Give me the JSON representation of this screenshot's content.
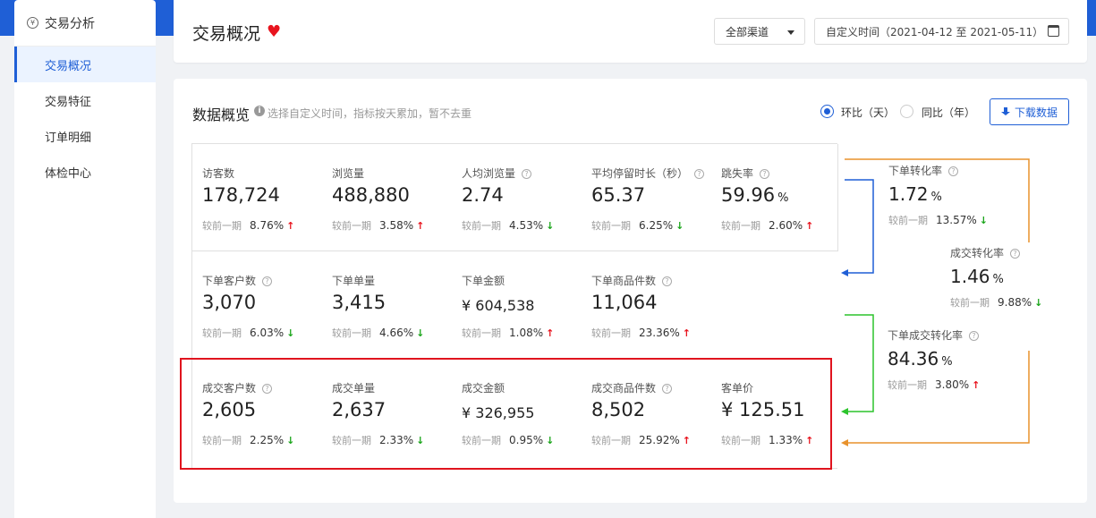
{
  "sidebar": {
    "title": "交易分析",
    "items": [
      {
        "label": "交易概况",
        "active": true
      },
      {
        "label": "交易特征",
        "active": false
      },
      {
        "label": "订单明细",
        "active": false
      },
      {
        "label": "体检中心",
        "active": false
      }
    ]
  },
  "header": {
    "title": "交易概况",
    "channel": "全部渠道",
    "date_range": "自定义时间（2021-04-12 至 2021-05-11）"
  },
  "overview": {
    "title": "数据概览",
    "hint": "选择自定义时间，指标按天累加，暂不去重",
    "radio_mom": "环比（天）",
    "radio_yoy": "同比（年）",
    "download": "下载数据",
    "compare_label": "较前一期"
  },
  "metrics": {
    "r1": [
      {
        "label": "访客数",
        "help": false,
        "value": "178,724",
        "unit": "",
        "pct": "8.76%",
        "dir": "up"
      },
      {
        "label": "浏览量",
        "help": false,
        "value": "488,880",
        "unit": "",
        "pct": "3.58%",
        "dir": "up"
      },
      {
        "label": "人均浏览量",
        "help": true,
        "value": "2.74",
        "unit": "",
        "pct": "4.53%",
        "dir": "down"
      },
      {
        "label": "平均停留时长（秒）",
        "help": true,
        "value": "65.37",
        "unit": "",
        "pct": "6.25%",
        "dir": "down"
      },
      {
        "label": "跳失率",
        "help": true,
        "value": "59.96",
        "unit": "%",
        "pct": "2.60%",
        "dir": "up"
      }
    ],
    "r2": [
      {
        "label": "下单客户数",
        "help": true,
        "value": "3,070",
        "unit": "",
        "pct": "6.03%",
        "dir": "down"
      },
      {
        "label": "下单单量",
        "help": false,
        "value": "3,415",
        "unit": "",
        "pct": "4.66%",
        "dir": "down"
      },
      {
        "label": "下单金额",
        "help": false,
        "value": "¥ 604,538",
        "unit": "",
        "pct": "1.08%",
        "dir": "up"
      },
      {
        "label": "下单商品件数",
        "help": true,
        "value": "11,064",
        "unit": "",
        "pct": "23.36%",
        "dir": "up"
      }
    ],
    "r3": [
      {
        "label": "成交客户数",
        "help": true,
        "value": "2,605",
        "unit": "",
        "pct": "2.25%",
        "dir": "down"
      },
      {
        "label": "成交单量",
        "help": false,
        "value": "2,637",
        "unit": "",
        "pct": "2.33%",
        "dir": "down"
      },
      {
        "label": "成交金额",
        "help": false,
        "value": "¥ 326,955",
        "unit": "",
        "pct": "0.95%",
        "dir": "down"
      },
      {
        "label": "成交商品件数",
        "help": true,
        "value": "8,502",
        "unit": "",
        "pct": "25.92%",
        "dir": "up"
      },
      {
        "label": "客单价",
        "help": false,
        "value": "¥ 125.51",
        "unit": "",
        "pct": "1.33%",
        "dir": "up"
      }
    ]
  },
  "conversion": {
    "order_rate": {
      "label": "下单转化率",
      "value": "1.72",
      "unit": "%",
      "pct": "13.57%",
      "dir": "down"
    },
    "deal_rate": {
      "label": "成交转化率",
      "value": "1.46",
      "unit": "%",
      "pct": "9.88%",
      "dir": "down"
    },
    "order_deal_rate": {
      "label": "下单成交转化率",
      "value": "84.36",
      "unit": "%",
      "pct": "3.80%",
      "dir": "up"
    }
  },
  "colors": {
    "accent": "#1f5fd6",
    "up": "#e8141e",
    "down": "#1aa51a",
    "orange": "#e8922c",
    "green": "#2cc42c"
  },
  "icons": {
    "heart": "heart-icon",
    "download": "download-icon",
    "calendar": "calendar-icon",
    "info": "info-icon",
    "help": "question-icon"
  }
}
